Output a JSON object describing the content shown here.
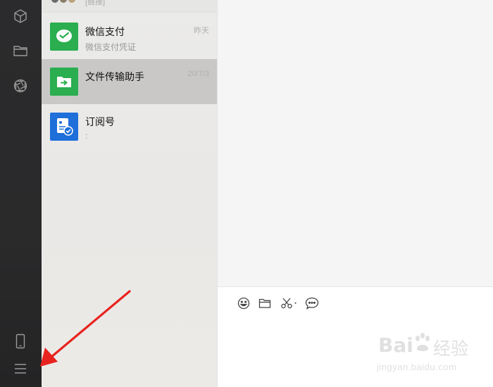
{
  "sidebar": {
    "top_icons": [
      "mini-program-cube-icon",
      "folder-icon",
      "moments-aperture-icon"
    ],
    "bottom_icons": [
      "phone-icon",
      "menu-icon"
    ]
  },
  "chat_list": {
    "partial_item": {
      "subtitle": "[链接]"
    },
    "items": [
      {
        "title": "微信支付",
        "subtitle": "微信支付凭证",
        "time": "昨天",
        "avatar_icon": "wechat-pay-icon",
        "avatar_color": "#2aae4f",
        "selected": false
      },
      {
        "title": "文件传输助手",
        "subtitle": "",
        "time": "20/7/3",
        "avatar_icon": "file-transfer-icon",
        "avatar_color": "#2aae4f",
        "selected": true
      },
      {
        "title": "订阅号",
        "subtitle": ":",
        "time": "",
        "avatar_icon": "subscription-icon",
        "avatar_color": "#1e6fd9",
        "selected": false
      }
    ]
  },
  "toolbar": {
    "tools": [
      "emoji-icon",
      "folder-icon",
      "scissors-screenshot-icon",
      "chat-history-icon"
    ]
  },
  "annotation": {
    "arrow_color": "#e8231f"
  },
  "watermark": {
    "brand": "Bai",
    "brand2": "经验",
    "url": "jingyan.baidu.com"
  },
  "colors": {
    "accent_green": "#2aae4f",
    "accent_blue": "#1e6fd9",
    "rail_bg": "#2b2b2d"
  }
}
